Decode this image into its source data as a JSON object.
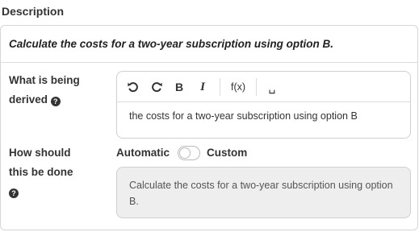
{
  "section": {
    "title": "Description"
  },
  "task": {
    "text": "Calculate the costs for a two-year subscription using option B."
  },
  "derived": {
    "label_line1": "What is being",
    "label_line2": "derived",
    "help_icon": "question-circle-icon",
    "editor_content": "the costs for a two-year subscription using option B"
  },
  "toolbar": {
    "undo_icon": "undo-icon",
    "redo_icon": "redo-icon",
    "bold_label": "B",
    "italic_label": "I",
    "formula_label": "f(x)",
    "space_label": "␣"
  },
  "how": {
    "label_line1": "How should",
    "label_line2": "this be done",
    "help_icon": "question-circle-icon",
    "automatic_label": "Automatic",
    "custom_label": "Custom",
    "toggle_state": "automatic",
    "method_text": "Calculate the costs for a two-year subscription using option B."
  }
}
